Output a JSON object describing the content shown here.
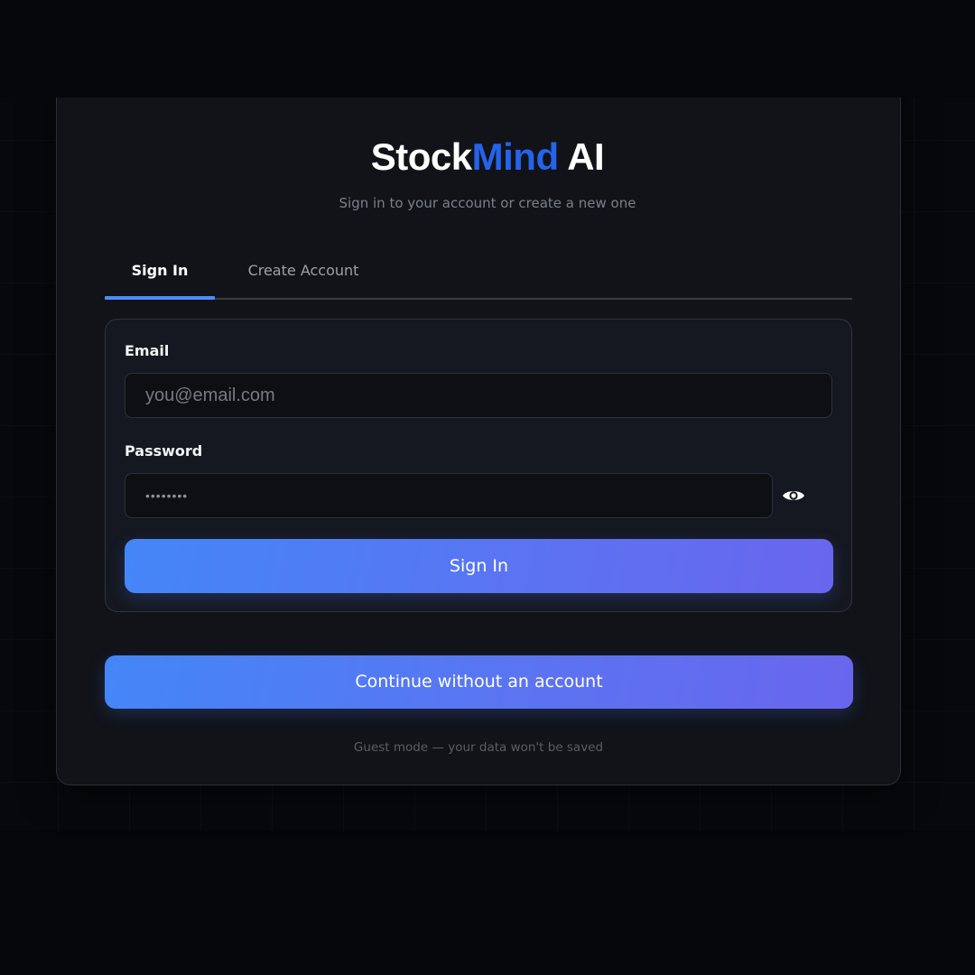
{
  "brand": {
    "name_part1": "Stock",
    "name_part2": "Mind",
    "name_part3": " AI"
  },
  "subtitle": "Sign in to your account or create a new one",
  "tabs": [
    {
      "label": "Sign In",
      "active": true
    },
    {
      "label": "Create Account",
      "active": false
    }
  ],
  "form": {
    "email_label": "Email",
    "email_placeholder": "you@email.com",
    "email_value": "",
    "password_label": "Password",
    "password_value": "••••••••",
    "password_toggle_icon": "eye-icon",
    "submit_label": "Sign In"
  },
  "guest": {
    "button_label": "Continue without an account",
    "note": "Guest mode — your data won't be saved"
  },
  "colors": {
    "background": "#05060a",
    "card": "#111318",
    "brand_accent": "#2563eb",
    "tab_underline": "#4f8bff",
    "button_gradient_start": "#4486f8",
    "button_gradient_end": "#6966ee"
  }
}
